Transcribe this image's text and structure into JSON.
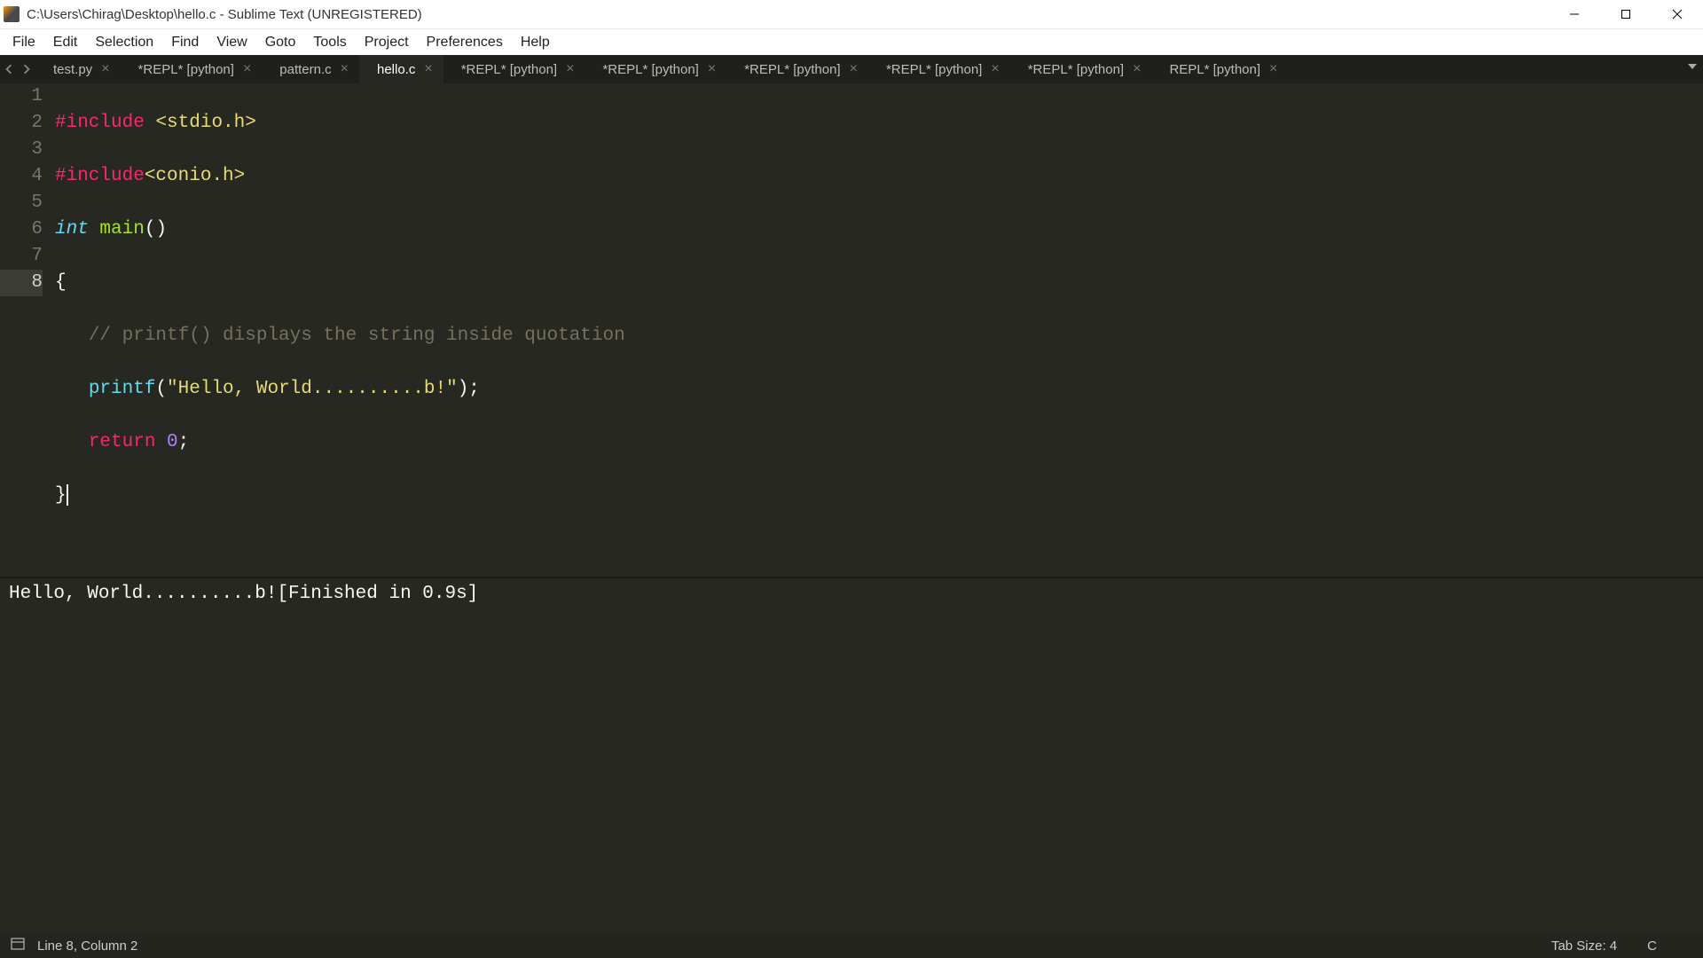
{
  "titlebar": {
    "title": "C:\\Users\\Chirag\\Desktop\\hello.c - Sublime Text (UNREGISTERED)"
  },
  "menu": [
    "File",
    "Edit",
    "Selection",
    "Find",
    "View",
    "Goto",
    "Tools",
    "Project",
    "Preferences",
    "Help"
  ],
  "tabs": [
    {
      "label": "test.py"
    },
    {
      "label": "*REPL* [python]"
    },
    {
      "label": "pattern.c"
    },
    {
      "label": "hello.c",
      "active": true
    },
    {
      "label": "*REPL* [python]"
    },
    {
      "label": "*REPL* [python]"
    },
    {
      "label": "*REPL* [python]"
    },
    {
      "label": "*REPL* [python]"
    },
    {
      "label": "*REPL* [python]"
    },
    {
      "label": "REPL* [python]"
    }
  ],
  "code": {
    "lines": [
      "1",
      "2",
      "3",
      "4",
      "5",
      "6",
      "7",
      "8"
    ],
    "l1_pre": "#include",
    "l1_sp": " ",
    "l1_lib": "<stdio.h>",
    "l2_pre": "#include",
    "l2_lib": "<conio.h>",
    "l3_type": "int",
    "l3_sp": " ",
    "l3_fn": "main",
    "l3_paren": "()",
    "l4": "{",
    "l5_indent": "   ",
    "l5_cmt": "// printf() displays the string inside quotation",
    "l6_indent": "   ",
    "l6_call": "printf",
    "l6_open": "(",
    "l6_str": "\"Hello, World..........b!\"",
    "l6_close": ");",
    "l7_indent": "   ",
    "l7_kw": "return",
    "l7_sp": " ",
    "l7_num": "0",
    "l7_semi": ";",
    "l8": "}"
  },
  "output": "Hello, World..........b![Finished in 0.9s]",
  "status": {
    "pos": "Line 8, Column 2",
    "tabsize": "Tab Size: 4",
    "syntax": "C"
  }
}
